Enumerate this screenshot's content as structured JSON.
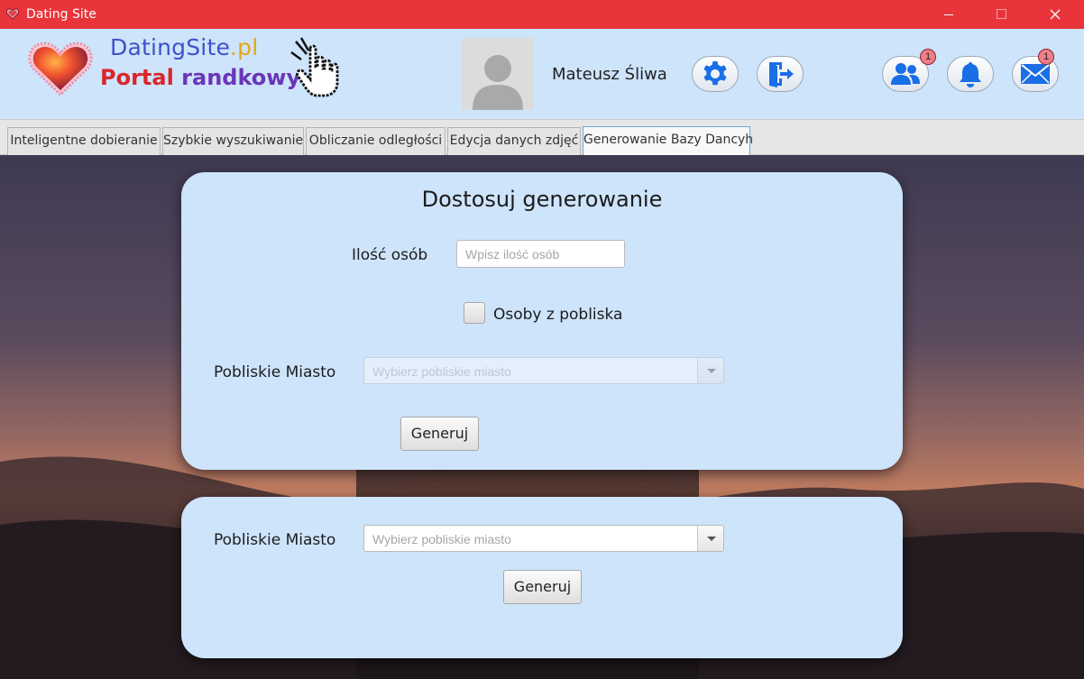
{
  "window": {
    "title": "Dating Site",
    "icons": {
      "app": "heart-icon",
      "minimize": "minimize-icon",
      "maximize": "maximize-icon",
      "close": "close-icon"
    }
  },
  "header": {
    "logo": {
      "name_main": "DatingSite",
      "name_suffix": ".pl",
      "tagline_part1": "Portal ",
      "tagline_part2": "randkowy"
    },
    "user_name": "Mateusz Śliwa",
    "buttons": [
      {
        "icon": "gear-icon",
        "badge": null
      },
      {
        "icon": "logout-icon",
        "badge": null
      },
      {
        "icon": "users-icon",
        "badge": "1"
      },
      {
        "icon": "bell-icon",
        "badge": null
      },
      {
        "icon": "mail-icon",
        "badge": "1"
      }
    ],
    "colors": {
      "background": "#cde4fb",
      "accent": "#1a6ee6",
      "title_bar": "#e8343a"
    }
  },
  "tabs": [
    {
      "label": "Inteligentne dobieranie",
      "active": false
    },
    {
      "label": "Szybkie wyszukiwanie",
      "active": false
    },
    {
      "label": "Obliczanie odległości",
      "active": false
    },
    {
      "label": "Edycja danych zdjęć",
      "active": false
    },
    {
      "label": "Generowanie Bazy Dancyh",
      "active": true
    }
  ],
  "generator_card": {
    "title": "Dostosuj generowanie",
    "count_label": "Ilość osób",
    "count_placeholder": "Wpisz ilość osób",
    "nearby_checkbox_label": "Osoby z pobliska",
    "nearby_checked": false,
    "city_label": "Pobliskie Miasto",
    "city_placeholder": "Wybierz pobliskie miasto",
    "city_disabled": true,
    "generate_label": "Generuj"
  },
  "city_card": {
    "city_label": "Pobliskie Miasto",
    "city_placeholder": "Wybierz pobliskie miasto",
    "generate_label": "Generuj"
  }
}
